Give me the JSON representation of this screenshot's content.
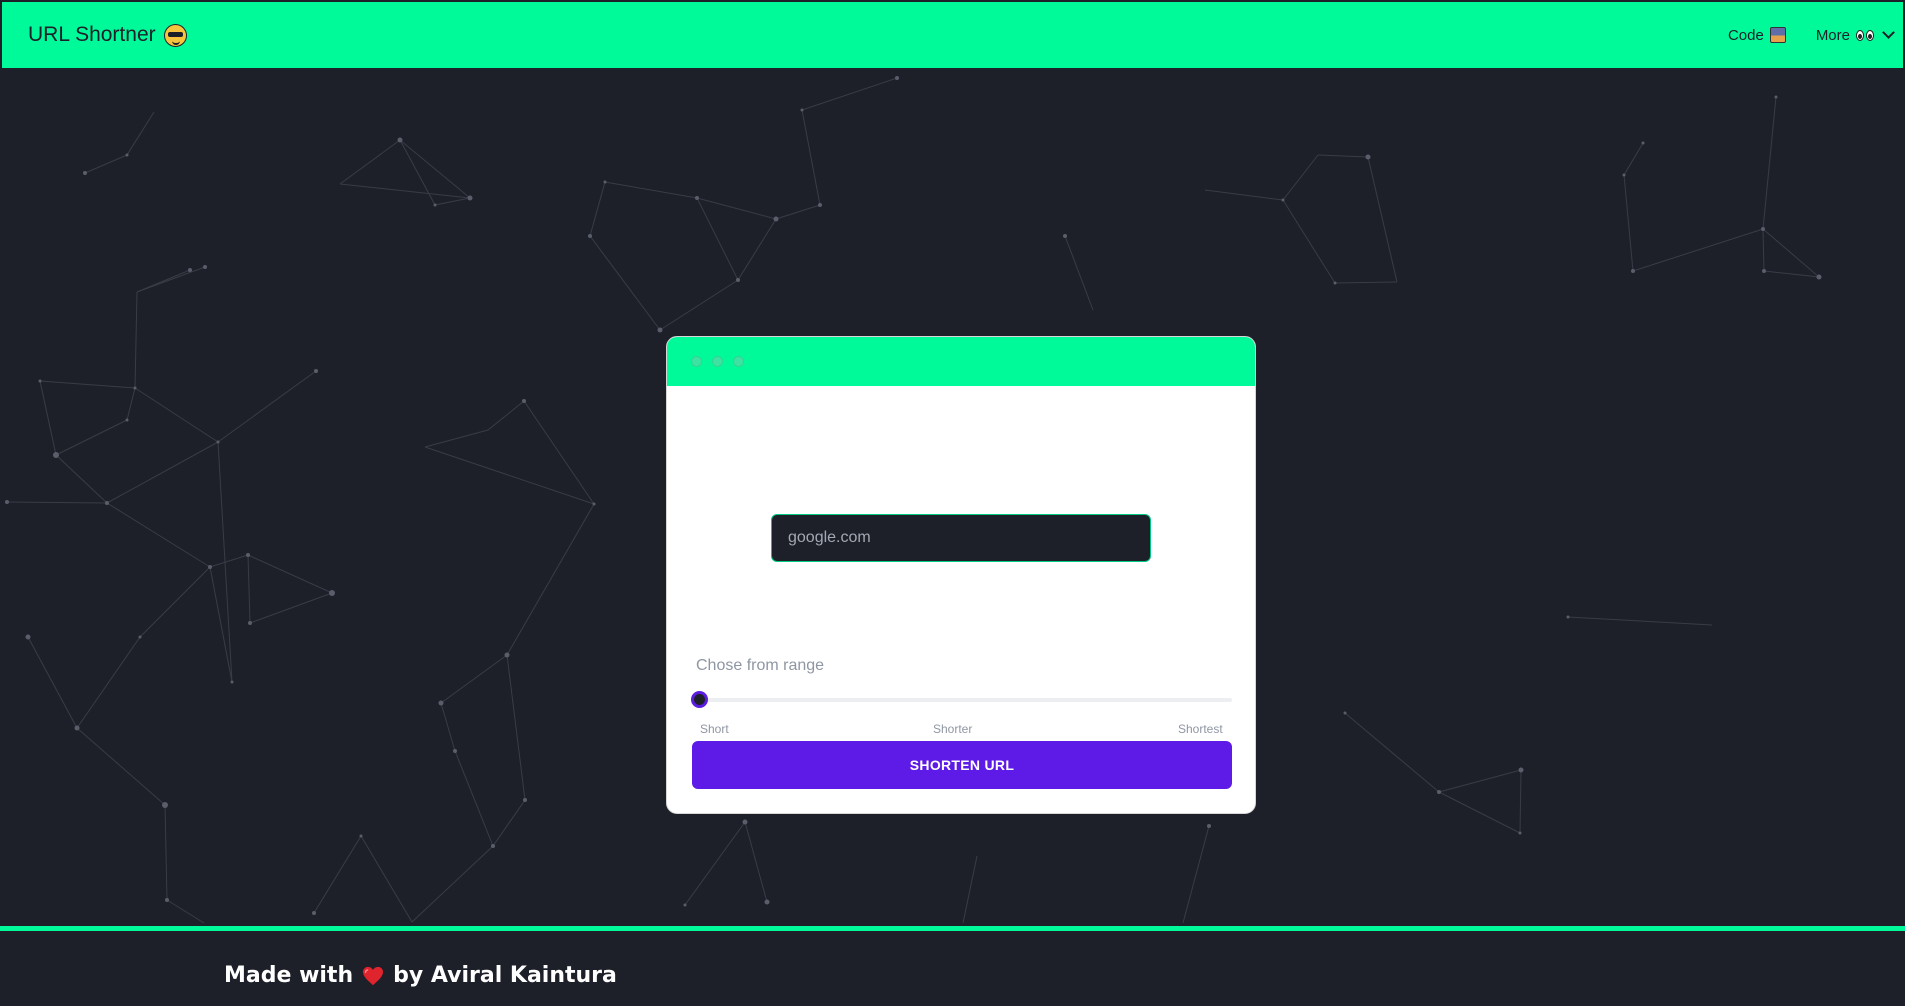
{
  "header": {
    "title": "URL Shortner",
    "title_emoji": "😎",
    "nav": [
      {
        "label": "Code",
        "emoji": "👩‍💻"
      },
      {
        "label": "More",
        "emoji": "👀"
      }
    ]
  },
  "form": {
    "url_placeholder": "google.com",
    "range_label": "Chose from range",
    "range_value": 0,
    "range_options": [
      "Short",
      "Shorter",
      "Shortest"
    ],
    "submit_label": "SHORTEN URL"
  },
  "footer": {
    "prefix": "Made with",
    "suffix": "by Aviral Kaintura"
  },
  "colors": {
    "accent": "#00fa9a",
    "background": "#1d2029",
    "button": "#5e1ae6"
  }
}
